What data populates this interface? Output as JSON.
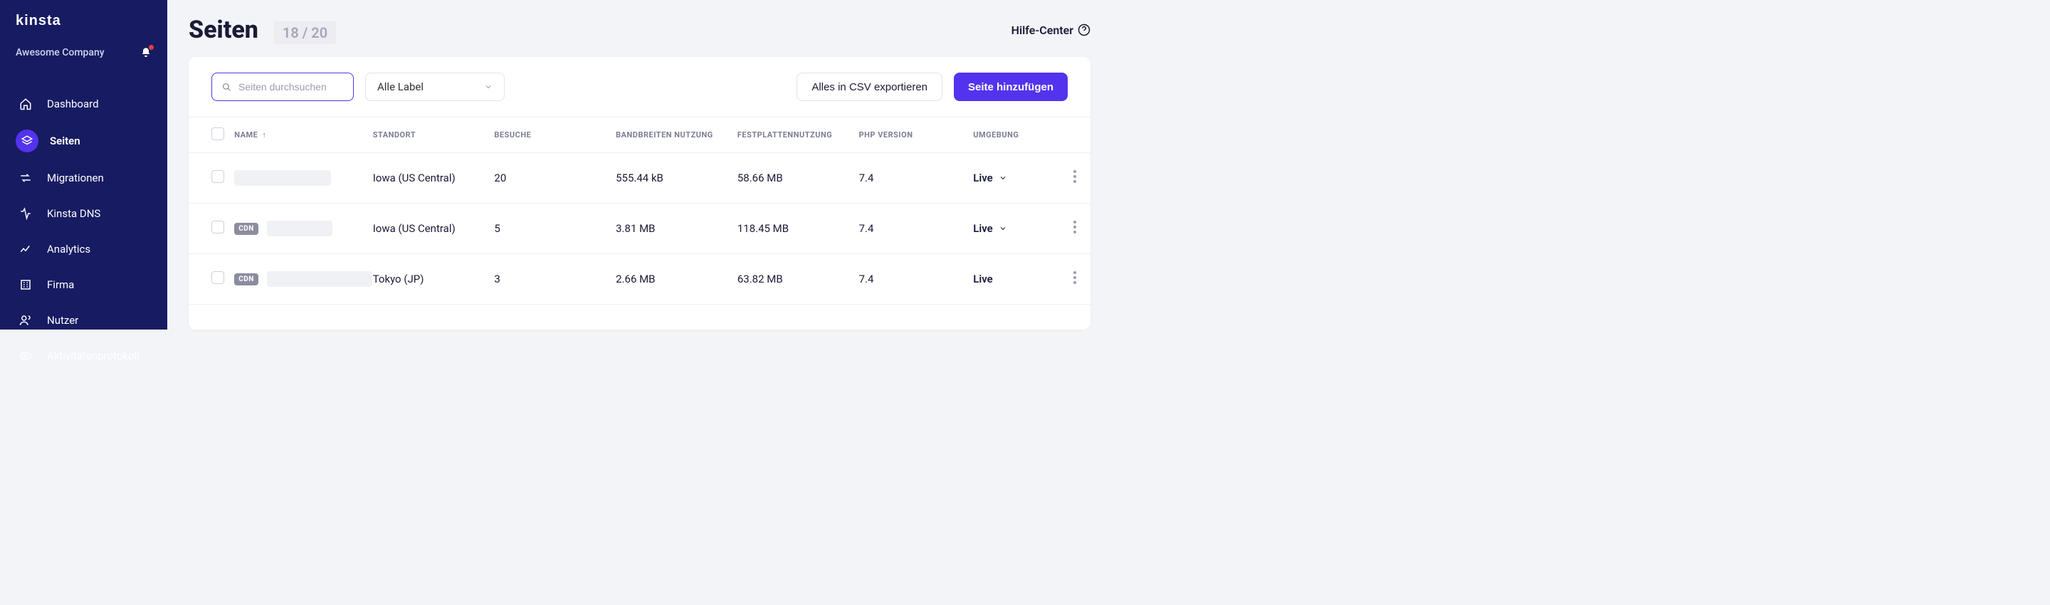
{
  "brand": "KINSTA",
  "company_name": "Awesome Company",
  "sidebar": {
    "items": [
      {
        "key": "dashboard",
        "label": "Dashboard"
      },
      {
        "key": "sites",
        "label": "Seiten"
      },
      {
        "key": "migrations",
        "label": "Migrationen"
      },
      {
        "key": "dns",
        "label": "Kinsta DNS"
      },
      {
        "key": "analytics",
        "label": "Analytics"
      },
      {
        "key": "company",
        "label": "Firma"
      },
      {
        "key": "users",
        "label": "Nutzer"
      },
      {
        "key": "activity",
        "label": "Aktivitätenprotokoll"
      }
    ]
  },
  "header": {
    "title": "Seiten",
    "count": "18 / 20",
    "help": "Hilfe-Center"
  },
  "toolbar": {
    "search_placeholder": "Seiten durchsuchen",
    "label_filter": "Alle Label",
    "export_csv": "Alles in CSV exportieren",
    "add_site": "Seite hinzufügen"
  },
  "table": {
    "columns": {
      "name": "NAME",
      "location": "STANDORT",
      "visits": "BESUCHE",
      "bandwidth": "BANDBREITEN NUTZUNG",
      "disk": "FESTPLATTENNUTZUNG",
      "php": "PHP VERSION",
      "env": "UMGEBUNG"
    },
    "rows": [
      {
        "cdn": false,
        "name_blur_width": 136,
        "location": "Iowa (US Central)",
        "visits": "20",
        "bandwidth": "555.44 kB",
        "disk": "58.66 MB",
        "php": "7.4",
        "env": "Live",
        "env_dropdown": true
      },
      {
        "cdn": true,
        "cdn_label": "CDN",
        "name_blur_width": 92,
        "location": "Iowa (US Central)",
        "visits": "5",
        "bandwidth": "3.81 MB",
        "disk": "118.45 MB",
        "php": "7.4",
        "env": "Live",
        "env_dropdown": true
      },
      {
        "cdn": true,
        "cdn_label": "CDN",
        "name_blur_width": 148,
        "location": "Tokyo (JP)",
        "visits": "3",
        "bandwidth": "2.66 MB",
        "disk": "63.82 MB",
        "php": "7.4",
        "env": "Live",
        "env_dropdown": false
      }
    ]
  }
}
